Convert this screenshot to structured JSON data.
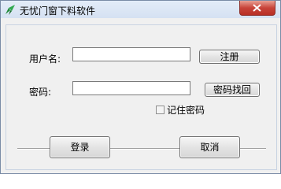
{
  "window": {
    "title": "无忧门窗下料软件"
  },
  "form": {
    "username_label": "用户名:",
    "username_value": "",
    "password_label": "密码:",
    "password_value": "",
    "register_label": "注册",
    "recover_label": "密码找回",
    "remember_label": "记住密码",
    "remember_checked": false
  },
  "actions": {
    "login_label": "登录",
    "cancel_label": "取消"
  },
  "colors": {
    "close_button": "#c8443a",
    "titlebar": "#dce6f4"
  },
  "icons": {
    "app": "app-logo-icon",
    "close": "close-icon",
    "checkbox": "checkbox-icon"
  }
}
